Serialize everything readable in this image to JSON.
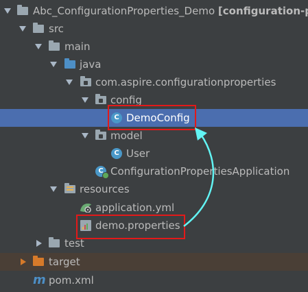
{
  "tree": {
    "root": {
      "name": "Abc_ConfigurationProperties_Demo",
      "module": "[configuration-pr"
    },
    "src": "src",
    "main": "main",
    "java": "java",
    "package": "com.aspire.configurationproperties",
    "config": "config",
    "demo_config": "DemoConfig",
    "model": "model",
    "user": "User",
    "application": "ConfigurationPropertiesApplication",
    "resources": "resources",
    "application_yml": "application.yml",
    "demo_properties": "demo.properties",
    "test": "test",
    "target": "target",
    "pom": "pom.xml"
  },
  "icons": {
    "folder": "folder-icon",
    "java_source": "source-folder-icon",
    "package": "package-icon",
    "class": "java-class-icon",
    "application": "spring-application-icon",
    "resources": "resources-folder-icon",
    "yaml": "yaml-file-icon",
    "properties": "properties-file-icon",
    "maven": "maven-icon"
  },
  "colors": {
    "background": "#3c3f41",
    "text": "#bbbbbb",
    "selected_row": "#4b6eaf",
    "highlight_box": "#e31919",
    "connector_arrow": "#62f4f4",
    "target_folder": "#d67a2a",
    "java_folder": "#4d8fc6"
  },
  "annotations": {
    "highlighted_items": [
      "DemoConfig",
      "demo.properties"
    ],
    "connector": "demo.properties → DemoConfig"
  }
}
